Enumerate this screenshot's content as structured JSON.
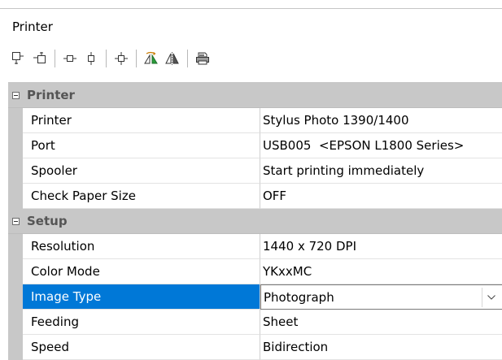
{
  "panel": {
    "title": "Printer"
  },
  "toolbar": {
    "buttons": [
      {
        "icon": "align-bottom-left-icon"
      },
      {
        "icon": "align-top-right-icon"
      },
      {
        "icon": "center-horizontal-icon"
      },
      {
        "icon": "center-vertical-icon"
      },
      {
        "icon": "center-both-icon"
      },
      {
        "icon": "mirror-color-icon"
      },
      {
        "icon": "flip-horizontal-icon"
      },
      {
        "icon": "printer-icon"
      }
    ]
  },
  "grid": {
    "categories": [
      {
        "label": "Printer",
        "rows": [
          {
            "name": "Printer",
            "value": "Stylus Photo 1390/1400"
          },
          {
            "name": "Port",
            "value": "USB005  <EPSON L1800 Series>"
          },
          {
            "name": "Spooler",
            "value": "Start printing immediately"
          },
          {
            "name": "Check Paper Size",
            "value": "OFF"
          }
        ]
      },
      {
        "label": "Setup",
        "rows": [
          {
            "name": "Resolution",
            "value": "1440 x 720 DPI"
          },
          {
            "name": "Color Mode",
            "value": "YKxxMC"
          },
          {
            "name": "Image Type",
            "value": "Photograph"
          },
          {
            "name": "Feeding",
            "value": "Sheet"
          },
          {
            "name": "Speed",
            "value": "Bidirection"
          }
        ]
      }
    ]
  },
  "colors": {
    "selection": "#0078d7",
    "category_band": "#c8c8c8"
  }
}
